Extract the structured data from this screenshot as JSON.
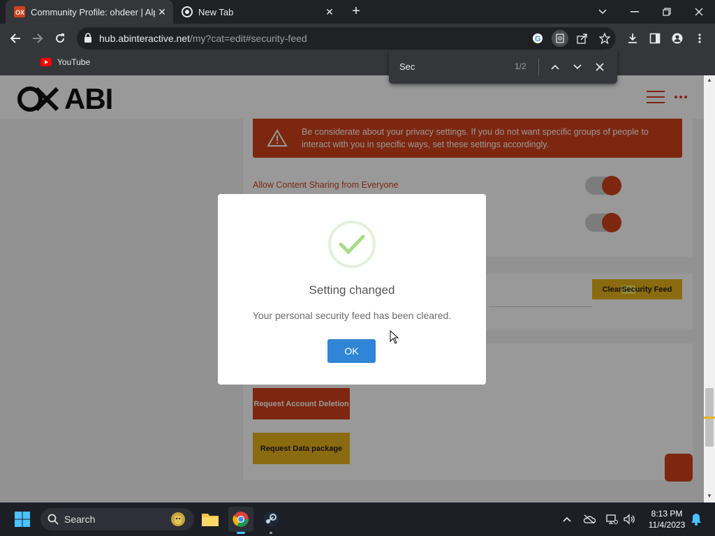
{
  "browser": {
    "tabs": [
      {
        "title": "Community Profile: ohdeer | Alp",
        "favicon": "abi-logo-icon",
        "active": true
      },
      {
        "title": "New Tab",
        "favicon": "chrome-icon",
        "active": false
      }
    ],
    "url_host": "hub.abinteractive.net",
    "url_path": "/my?cat=edit#security-feed",
    "bookmarks": [
      {
        "label": "YouTube",
        "icon": "youtube-icon"
      }
    ],
    "find": {
      "query": "Sec",
      "count": "1/2"
    }
  },
  "site": {
    "logo_text": "ABI",
    "alert_text": "Be considerate about your privacy settings. If you do not want specific groups of people to interact with you in specific ways, set these settings accordingly.",
    "settings": [
      {
        "label": "Allow Content Sharing from Everyone",
        "enabled": true
      },
      {
        "label": "",
        "enabled": true
      }
    ],
    "clear_feed_prefix": "Clear ",
    "clear_feed_highlight": "Sec",
    "clear_feed_suffix": "urity Feed",
    "request_deletion": "Request Account Deletion",
    "request_data": "Request Data package",
    "colors": {
      "brand": "#d0421b",
      "warn": "#e8b21a",
      "ok": "#3085d6"
    }
  },
  "modal": {
    "title": "Setting changed",
    "text": "Your personal security feed has been cleared.",
    "ok_label": "OK",
    "icon": "success-check-icon"
  },
  "taskbar": {
    "search_label": "Search",
    "time": "8:13 PM",
    "date": "11/4/2023"
  }
}
